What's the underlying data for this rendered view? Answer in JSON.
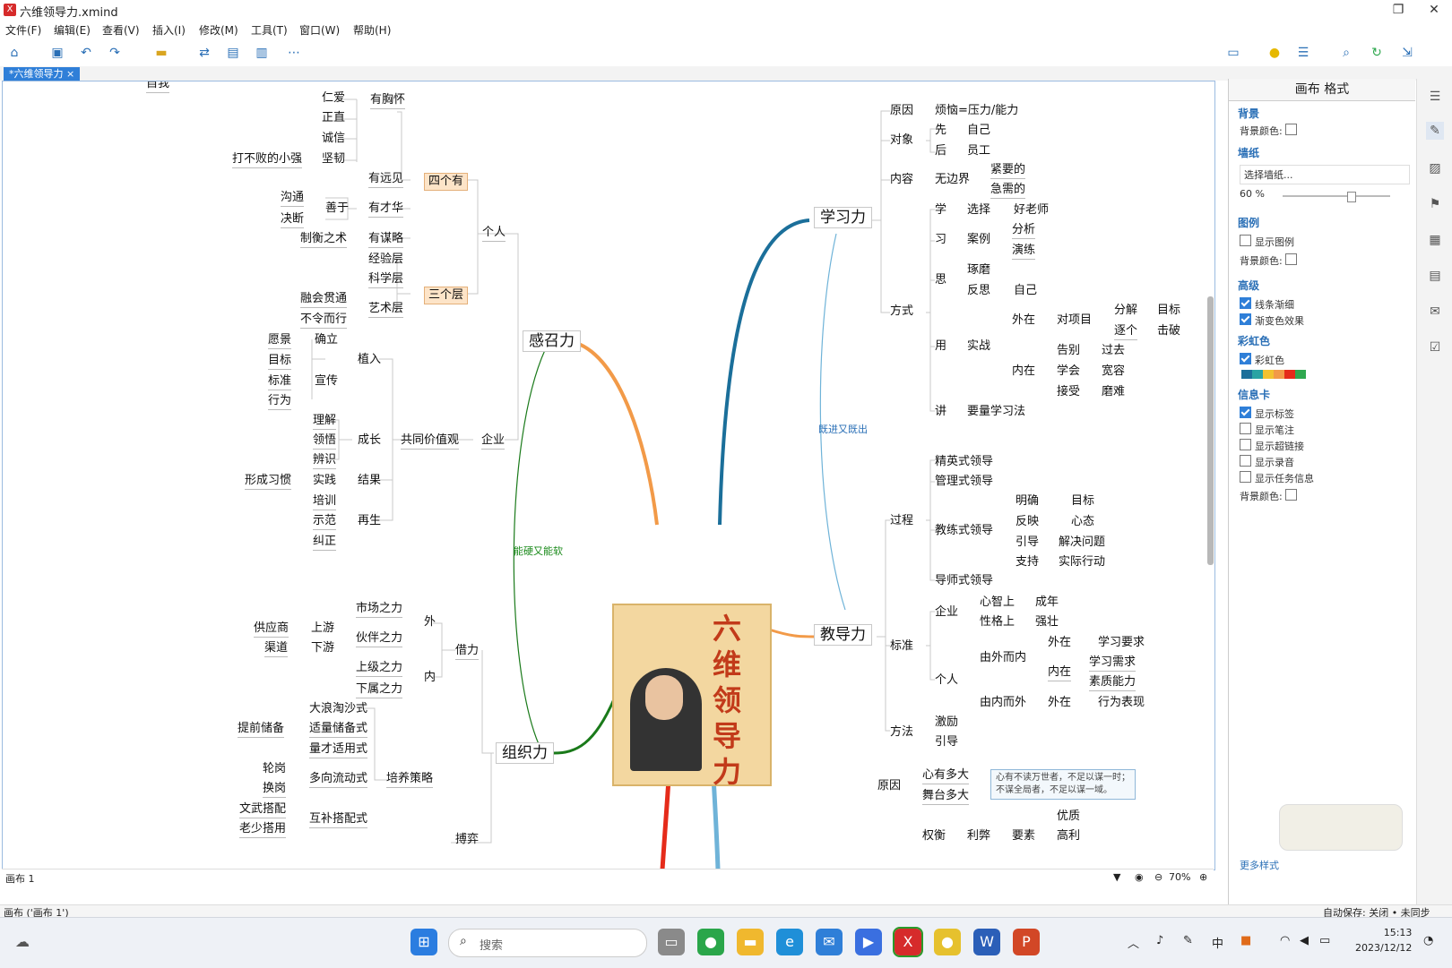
{
  "window": {
    "title": "六维领导力.xmind",
    "restore": "❐",
    "close": "✕"
  },
  "menu": [
    "文件(F)",
    "编辑(E)",
    "查看(V)",
    "插入(I)",
    "修改(M)",
    "工具(T)",
    "窗口(W)",
    "帮助(H)"
  ],
  "tab": "*六维领导力 ×",
  "mindmap": {
    "center_title": "六维领导力",
    "top_cut": "自我",
    "left": {
      "ganzhao": "感召力",
      "geren": "个人",
      "sigeyou": "四个有",
      "sangeceng": "三个层",
      "youxionghuai": "有胸怀",
      "renai": "仁爱",
      "zhengzhi": "正直",
      "chengxin": "诚信",
      "jianren": "坚韧",
      "dabubai": "打不败的小强",
      "youyuanjian": "有远见",
      "youcaihua": "有才华",
      "shanyu": "善于",
      "goutong": "沟通",
      "jueduan": "决断",
      "youmoulue": "有谋略",
      "zhiheng": "制衡之术",
      "jingyan": "经验层",
      "kexue": "科学层",
      "yishu": "艺术层",
      "ronghui": "融会贯通",
      "buling": "不令而行",
      "qiye": "企业",
      "gongtong": "共同价值观",
      "zhiru": "植入",
      "yuanjing": "愿景",
      "queli": "确立",
      "mubiao": "目标",
      "biaozhun": "标准",
      "xingwei": "行为",
      "xuanchuan": "宣传",
      "chengzhang": "成长",
      "lijie": "理解",
      "lingwu": "领悟",
      "bianshi": "辨识",
      "jieguo": "结果",
      "shijian": "实践",
      "xingcheng": "形成习惯",
      "zaisheng": "再生",
      "peixun": "培训",
      "shifan": "示范",
      "jiuzheng": "纠正",
      "zuzhi": "组织力",
      "jieli": "借力",
      "wai": "外",
      "nei": "内",
      "shichang": "市场之力",
      "huoban": "伙伴之力",
      "shangyou": "上游",
      "xiayou": "下游",
      "gongying": "供应商",
      "qudao": "渠道",
      "shangji": "上级之力",
      "xiashu": "下属之力",
      "peiyang": "培养策略",
      "taosha": "大浪淘沙式",
      "chubei": "适量储备式",
      "tiqian": "提前储备",
      "shiyong": "量才适用式",
      "liudong": "多向流动式",
      "lungang": "轮岗",
      "huangang": "换岗",
      "hubu": "互补搭配式",
      "wenwu": "文武搭配",
      "laoshao": "老少搭用",
      "boqi": "搏弈",
      "nengying": "能硬又能软"
    },
    "right": {
      "xuexi": "学习力",
      "yuanyin": "原因",
      "fannao": "烦恼=压力/能力",
      "duixiang": "对象",
      "xian": "先",
      "ziji": "自己",
      "hou": "后",
      "yuangong": "员工",
      "neirong": "内容",
      "wubianjie": "无边界",
      "jinyao": "紧要的",
      "jixu": "急需的",
      "fangshi": "方式",
      "xue": "学",
      "xuanze": "选择",
      "haolaoshi": "好老师",
      "xi": "习",
      "anli": "案例",
      "fenxi": "分析",
      "yanlian": "演练",
      "si": "思",
      "zhuomo": "琢磨",
      "fansi": "反思",
      "ziji2": "自己",
      "yong": "用",
      "shizhan": "实战",
      "waizai": "外在",
      "duixiangmu": "对项目",
      "fenjie": "分解",
      "mubiao2": "目标",
      "zhuge": "逐个",
      "jipo": "击破",
      "neizai": "内在",
      "gaobie": "告别",
      "guoqu": "过去",
      "xuehui": "学会",
      "kuanrong": "宽容",
      "jieshou": "接受",
      "monan": "磨难",
      "jiang": "讲",
      "yaoliang": "要量学习法",
      "jinjin": "既进又既出",
      "jiaodao": "教导力",
      "guocheng": "过程",
      "jingying": "精英式领导",
      "guanli": "管理式领导",
      "jiaolian": "教练式领导",
      "daoshi": "导师式领导",
      "mingque": "明确",
      "mubiao3": "目标",
      "fanying": "反映",
      "xintai": "心态",
      "yindao": "引导",
      "jiejue": "解决问题",
      "zhichi": "支持",
      "shiji": "实际行动",
      "biaozhun2": "标准",
      "qiye2": "企业",
      "xinzhi": "心智上",
      "chengnian": "成年",
      "xingge": "性格上",
      "qiangzhuang": "强壮",
      "geren2": "个人",
      "youwai": "由外而内",
      "wai1": "外在",
      "xuexiyaoqiu": "学习要求",
      "neizai2": "内在",
      "xuexixuqiu": "学习需求",
      "suzhi": "素质能力",
      "younei": "由内而外",
      "wai2": "外在",
      "xingwei2": "行为表现",
      "fangfa": "方法",
      "jili": "激励",
      "yindao2": "引导",
      "yuanyin2": "原因",
      "xinyou": "心有多大",
      "wutai": "舞台多大",
      "note_line1": "心有不读万世者，不足以谋一时；",
      "note_line2": "不谋全局者，不足以谋一域。",
      "quanheng": "权衡",
      "libi": "利弊",
      "yaosu": "要素",
      "youzhi": "优质",
      "gaoli": "高利"
    }
  },
  "canvas_footer": {
    "sheet": "画布 1",
    "zoom": "70%"
  },
  "panel": {
    "header": "画布 格式",
    "bg": "背景",
    "bgcolor": "背景颜色:",
    "wallpaper": "墙纸",
    "wp_select": "选择墙纸...",
    "opacity": "60 %",
    "legend": "图例",
    "show_legend": "显示图例",
    "legend_bg": "背景颜色:",
    "advanced": "高级",
    "tapered": "线条渐细",
    "gradient": "渐变色效果",
    "rainbow": "彩虹色",
    "rainbow_cb": "彩虹色",
    "infocard": "信息卡",
    "ic1": "显示标签",
    "ic2": "显示笔注",
    "ic3": "显示超链接",
    "ic4": "显示录音",
    "ic5": "显示任务信息",
    "ic_bg": "背景颜色:",
    "theme_link": "更多样式"
  },
  "statusbar": {
    "left": "画布 ('画布 1')",
    "right": "自动保存: 关闭 • 未同步"
  },
  "taskbar": {
    "search": "搜索",
    "ime": "中",
    "time": "15:13",
    "date": "2023/12/12"
  },
  "colors": {
    "accent": "#2f7fd8",
    "orange": "#f29a48",
    "teal": "#1b6f9a",
    "green": "#1a7a1a",
    "red": "#e52b1a",
    "lightblue": "#6fb3d8"
  },
  "rainbow_swatches": [
    "#1b6f9a",
    "#29a3a3",
    "#f2c230",
    "#f29a48",
    "#e52b1a",
    "#2fa84f"
  ]
}
